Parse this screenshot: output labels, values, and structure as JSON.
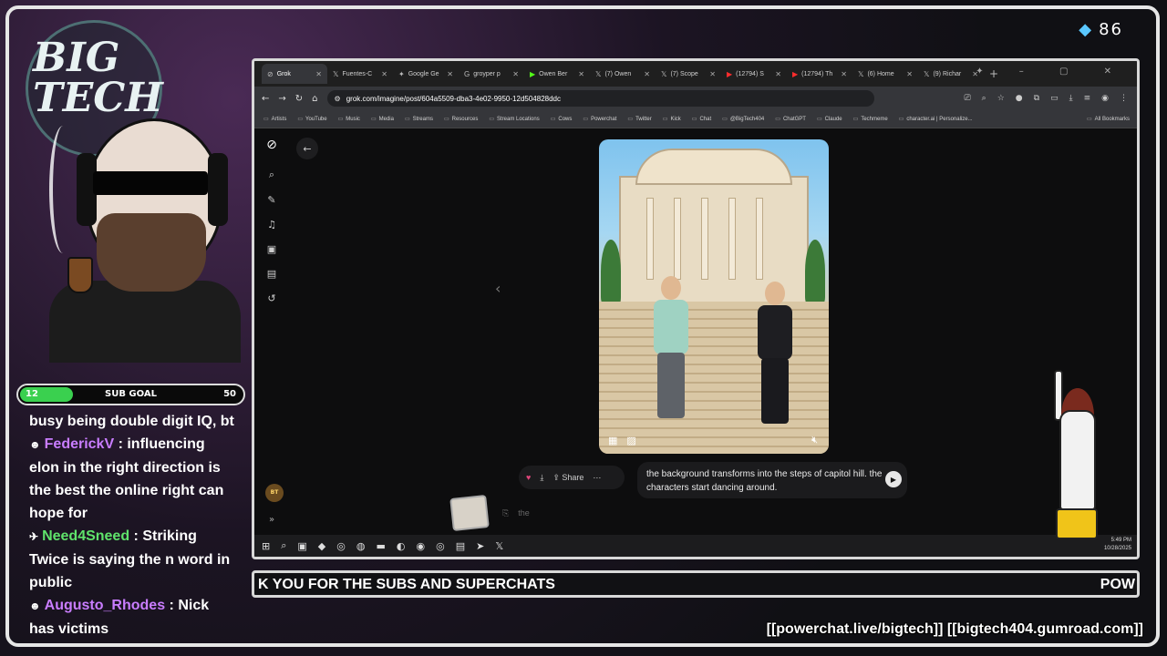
{
  "overlay": {
    "gem_count": "86",
    "logo_text": "BIG TECH",
    "sub_goal": {
      "current": "12",
      "title": "SUB GOAL",
      "target": "50",
      "fill_fraction": 0.24
    },
    "ticker_main": "K YOU FOR THE SUBS AND SUPERCHATS",
    "ticker_tail": "POW",
    "footer_links": "[[powerchat.live/bigtech]] [[bigtech404.gumroad.com]]"
  },
  "chat": [
    {
      "user": "",
      "text": "busy being double digit IQ, bt",
      "color": "#ffffff"
    },
    {
      "user": "FederickV",
      "text": " : influencing elon in the right direction is the best the online right can hope for",
      "color": "#c97dff"
    },
    {
      "user": "Need4Sneed",
      "text": " : Striking Twice is saying the n word in public",
      "color": "#5fe36b"
    },
    {
      "user": "Augusto_Rhodes",
      "text": " : Nick has victims",
      "color": "#c97dff"
    }
  ],
  "browser": {
    "tabs": [
      {
        "label": "Grok",
        "active": true
      },
      {
        "label": "Fuentes-C"
      },
      {
        "label": "Google Ge"
      },
      {
        "label": "groyper p"
      },
      {
        "label": "Owen Ber"
      },
      {
        "label": "(7) Owen"
      },
      {
        "label": "(7) Scope"
      },
      {
        "label": "(12794) S"
      },
      {
        "label": "(12794) Th"
      },
      {
        "label": "(6) Home"
      },
      {
        "label": "(9) Richar"
      }
    ],
    "new_tab": "+",
    "url": "grok.com/imagine/post/604a5509-dba3-4e02-9950-12d504828ddc",
    "bookmarks": [
      "Artists",
      "YouTube",
      "Music",
      "Media",
      "Streams",
      "Resources",
      "Stream Locations",
      "Cows",
      "Powerchat",
      "Twitter",
      "Kick",
      "Chat",
      "@BigTech404",
      "ChatGPT",
      "Claude",
      "Techmeme",
      "character.ai | Personalize..."
    ],
    "all_bookmarks": "All Bookmarks"
  },
  "grok": {
    "share_label": "Share",
    "prompt_text": "the background transforms into the steps of capitol hill. the characters start dancing around.",
    "input_placeholder": "the"
  },
  "taskbar": {
    "time": "5:49 PM",
    "date": "10/28/2025"
  }
}
